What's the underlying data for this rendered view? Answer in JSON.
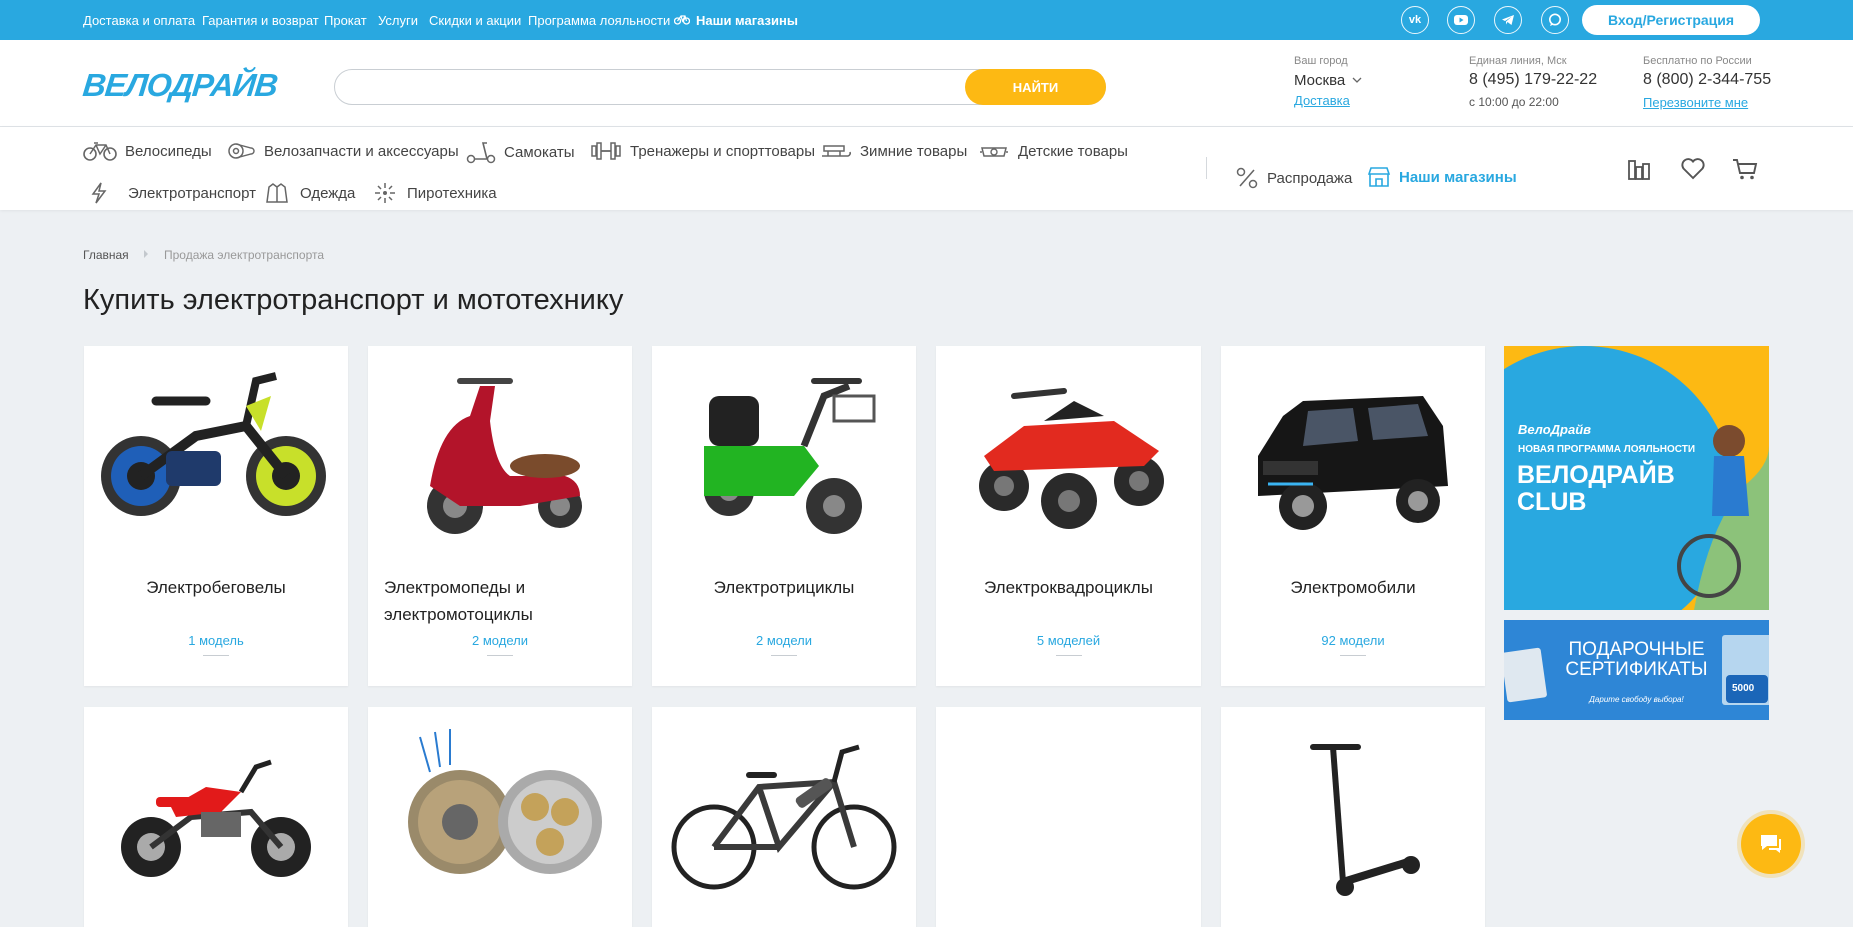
{
  "topbar": {
    "links": [
      "Доставка и оплата",
      "Гарантия и возврат",
      "Прокат",
      "Услуги",
      "Скидки и акции",
      "Программа лояльности"
    ],
    "stores_label": "Наши магазины",
    "social_icons": [
      "vk-icon",
      "youtube-icon",
      "telegram-icon",
      "chat-bubble-icon"
    ],
    "login_label": "Вход/Регистрация"
  },
  "header": {
    "logo_text": "ВЕЛОДРАЙВ",
    "search_placeholder": "",
    "search_button": "НАЙТИ",
    "city_label": "Ваш город",
    "city_value": "Москва",
    "delivery_link": "Доставка",
    "hotline_label": "Единая линия, Мск",
    "hotline_phone": "8 (495) 179-22-22",
    "hotline_hours": "с 10:00 до 22:00",
    "free_label": "Бесплатно по России",
    "free_phone": "8 (800) 2-344-755",
    "callback_link": "Перезвоните мне"
  },
  "nav": {
    "items": [
      "Велосипеды",
      "Велозапчасти и аксессуары",
      "Самокаты",
      "Тренажеры и спорттовары",
      "Зимние товары",
      "Детские товары",
      "Электротранспорт",
      "Одежда",
      "Пиротехника"
    ],
    "sale_label": "Распродажа",
    "stores_label": "Наши магазины"
  },
  "breadcrumb": {
    "home": "Главная",
    "current": "Продажа электротранспорта"
  },
  "page": {
    "title": "Купить электротранспорт и мототехнику"
  },
  "categories": [
    {
      "title": "Электробеговелы",
      "count": "1 модель"
    },
    {
      "title": "Электромопеды и электромотоциклы",
      "count": "2 модели"
    },
    {
      "title": "Электротрициклы",
      "count": "2 модели"
    },
    {
      "title": "Электроквадроциклы",
      "count": "5 моделей"
    },
    {
      "title": "Электромобили",
      "count": "92 модели"
    }
  ],
  "banners": {
    "loyalty_brand": "ВелоДрайв",
    "loyalty_sub": "НОВАЯ ПРОГРАММА ЛОЯЛЬНОСТИ",
    "loyalty_title1": "ВЕЛОДРАЙВ",
    "loyalty_title2": "CLUB",
    "gift_title1": "ПОДАРОЧНЫЕ",
    "gift_title2": "СЕРТИФИКАТЫ",
    "gift_sub": "Дарите свободу выбора!",
    "gift_amount": "5000"
  },
  "colors": {
    "accent": "#29a8e0",
    "button": "#fdb913",
    "background": "#edf0f3"
  }
}
